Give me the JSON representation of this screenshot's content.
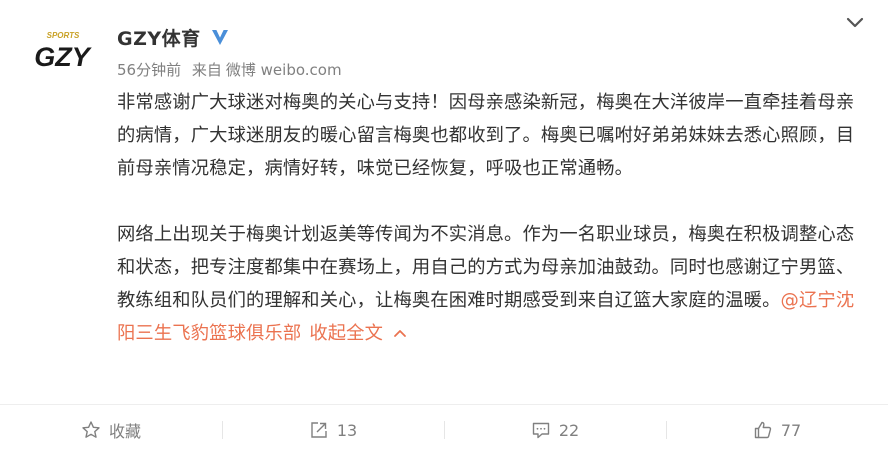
{
  "account": {
    "name": "GZY体育",
    "logo_text": "GZY",
    "logo_tag": "SPORTS",
    "verified_icon": "verified-v-icon",
    "verified_color": "#4a8fd9"
  },
  "meta": {
    "time": "56分钟前",
    "from_label": "来自",
    "source": "微博 weibo.com"
  },
  "post": {
    "paragraph1": "非常感谢广大球迷对梅奥的关心与支持！因母亲感染新冠，梅奥在大洋彼岸一直牵挂着母亲的病情，广大球迷朋友的暖心留言梅奥也都收到了。梅奥已嘱咐好弟弟妹妹去悉心照顾，目前母亲情况稳定，病情好转，味觉已经恢复，呼吸也正常通畅。",
    "paragraph2": "网络上出现关于梅奥计划返美等传闻为不实消息。作为一名职业球员，梅奥在积极调整心态和状态，把专注度都集中在赛场上，用自己的方式为母亲加油鼓劲。同时也感谢辽宁男篮、教练组和队员们的理解和关心，让梅奥在困难时期感受到来自辽篮大家庭的温暖。",
    "mention": "@辽宁沈阳三生飞豹篮球俱乐部",
    "collapse_label": "收起全文",
    "link_color": "#eb7350"
  },
  "actions": {
    "favorite": {
      "icon": "star-icon",
      "label": "收藏"
    },
    "repost": {
      "icon": "repost-icon",
      "count": "13"
    },
    "comment": {
      "icon": "comment-icon",
      "count": "22"
    },
    "like": {
      "icon": "thumbs-up-icon",
      "count": "77"
    }
  },
  "menu_icon": "chevron-down-icon"
}
